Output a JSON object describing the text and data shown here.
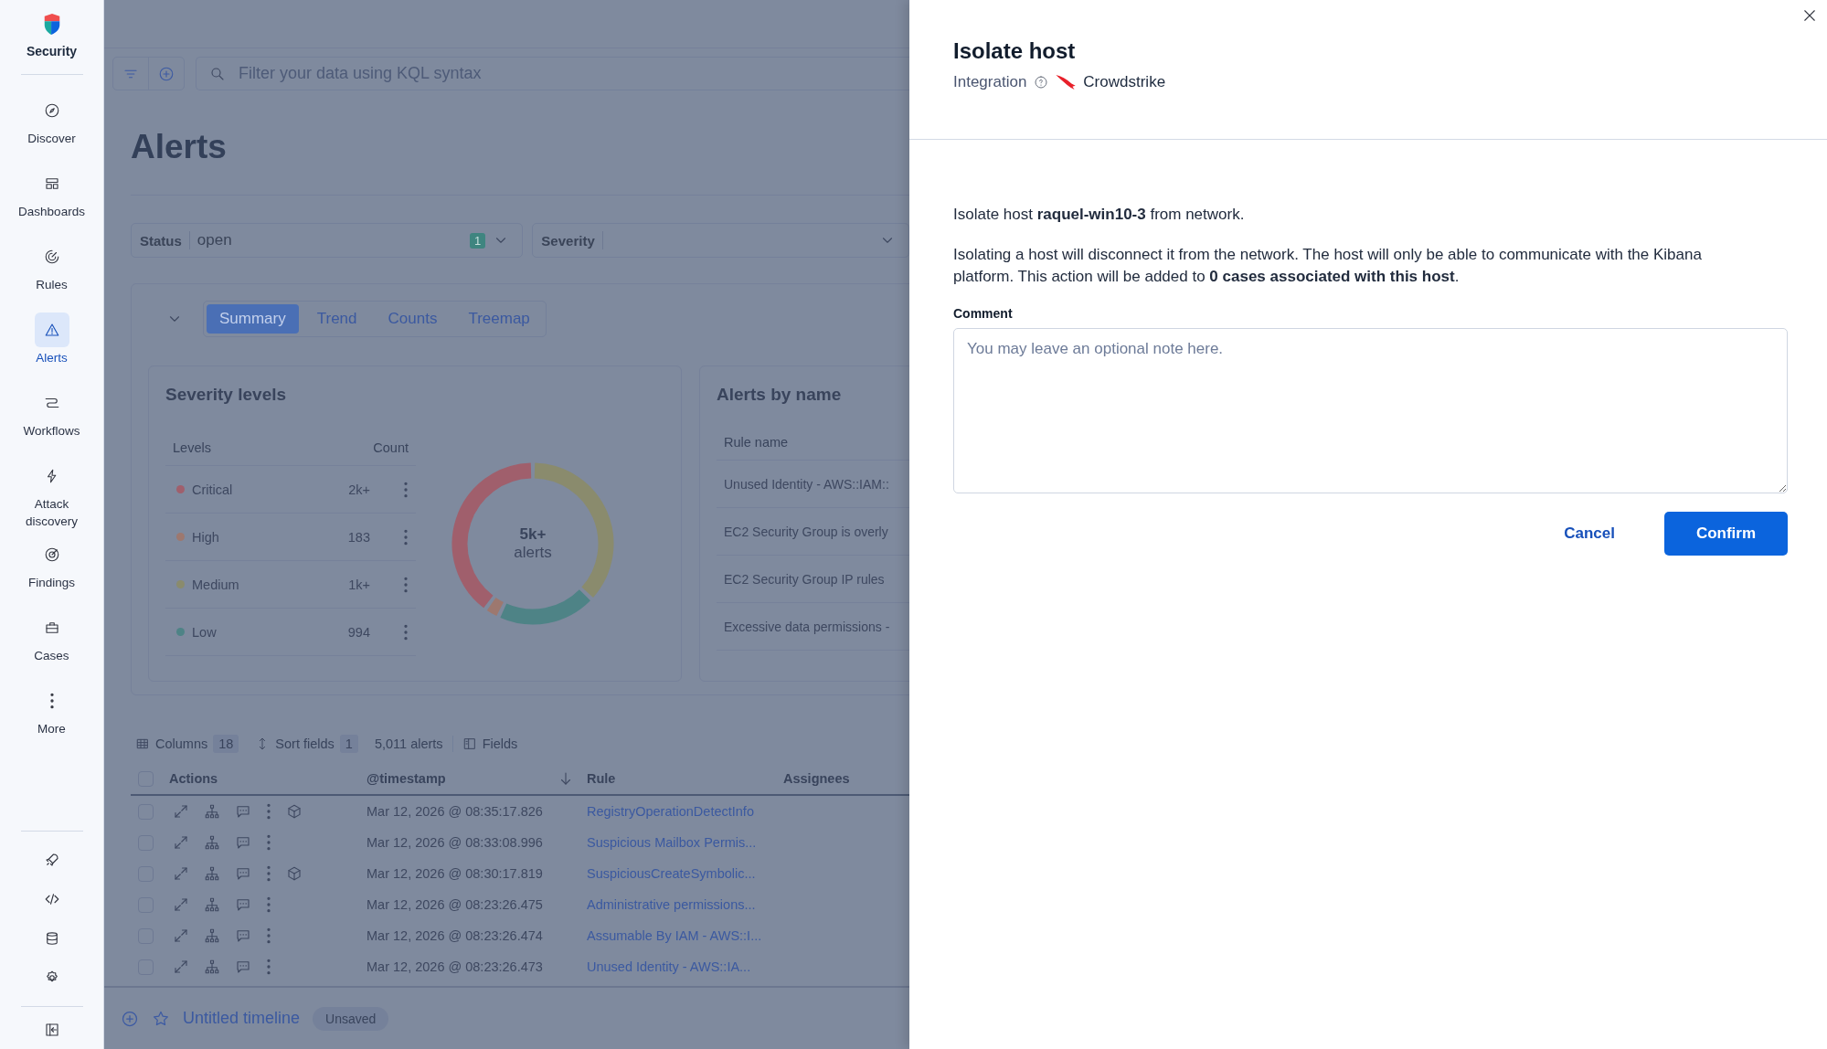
{
  "sidebar": {
    "brand": "Security",
    "items": [
      {
        "label": "Discover",
        "selected": false
      },
      {
        "label": "Dashboards",
        "selected": false
      },
      {
        "label": "Rules",
        "selected": false
      },
      {
        "label": "Alerts",
        "selected": true
      },
      {
        "label": "Workflows",
        "selected": false
      },
      {
        "label": "Attack discovery",
        "selected": false
      },
      {
        "label": "Findings",
        "selected": false
      },
      {
        "label": "Cases",
        "selected": false
      },
      {
        "label": "More",
        "selected": false
      }
    ]
  },
  "query_bar": {
    "placeholder": "Filter your data using KQL syntax"
  },
  "page_title": "Alerts",
  "filters": [
    {
      "label": "Status",
      "value": "open",
      "count": "1"
    },
    {
      "label": "Severity"
    }
  ],
  "view_tabs": [
    {
      "label": "Summary",
      "selected": true
    },
    {
      "label": "Trend",
      "selected": false
    },
    {
      "label": "Counts",
      "selected": false
    },
    {
      "label": "Treemap",
      "selected": false
    }
  ],
  "severity_levels": {
    "title": "Severity levels",
    "columns": [
      "Levels",
      "Count"
    ],
    "rows": [
      {
        "level": "Critical",
        "count": "2k+",
        "color": "#a05f6c"
      },
      {
        "level": "High",
        "count": "183",
        "color": "#9d786f"
      },
      {
        "level": "Medium",
        "count": "1k+",
        "color": "#8a8b6d"
      },
      {
        "level": "Low",
        "count": "994",
        "color": "#4e8386"
      }
    ],
    "total": "5k+",
    "total_unit": "alerts"
  },
  "alerts_by_name": {
    "title": "Alerts by name",
    "column": "Rule name",
    "rows": [
      "Unused Identity - AWS::IAM::",
      "EC2 Security Group is overly",
      "EC2 Security Group IP rules",
      "Excessive data permissions -"
    ]
  },
  "table": {
    "toolbar": {
      "columns_label": "Columns",
      "columns_count": "18",
      "sort_label": "Sort fields",
      "sort_count": "1",
      "total": "5,011 alerts",
      "fields_label": "Fields"
    },
    "all_checked": false,
    "columns": [
      "Actions",
      "@timestamp",
      "Rule",
      "Assignees"
    ],
    "rows": [
      {
        "checked": false,
        "session_view": true,
        "timestamp": "Mar 12, 2026 @ 08:35:17.826",
        "rule": "RegistryOperationDetectInfo"
      },
      {
        "checked": false,
        "session_view": false,
        "timestamp": "Mar 12, 2026 @ 08:33:08.996",
        "rule": "Suspicious Mailbox Permis..."
      },
      {
        "checked": false,
        "session_view": true,
        "timestamp": "Mar 12, 2026 @ 08:30:17.819",
        "rule": "SuspiciousCreateSymbolic..."
      },
      {
        "checked": false,
        "session_view": false,
        "timestamp": "Mar 12, 2026 @ 08:23:26.475",
        "rule": "Administrative permissions..."
      },
      {
        "checked": false,
        "session_view": false,
        "timestamp": "Mar 12, 2026 @ 08:23:26.474",
        "rule": "Assumable By IAM - AWS::I..."
      },
      {
        "checked": false,
        "session_view": false,
        "timestamp": "Mar 12, 2026 @ 08:23:26.473",
        "rule": "Unused Identity - AWS::IA..."
      }
    ]
  },
  "timeline": {
    "title": "Untitled timeline",
    "badge": "Unsaved"
  },
  "flyout": {
    "title": "Isolate host",
    "integration_label": "Integration",
    "integration": "Crowdstrike",
    "message": "Isolate host **raquel-win10-3** from network.",
    "description": "Isolating a host will disconnect it from the network. The host will only be able to communicate with the Kibana platform. This action will be added to **0 cases associated with this host**.",
    "comment_label": "Comment",
    "comment_placeholder": "You may leave an optional note here.",
    "buttons": [
      {
        "label": "Cancel",
        "kind": "secondary"
      },
      {
        "label": "Confirm",
        "kind": "primary"
      }
    ]
  }
}
